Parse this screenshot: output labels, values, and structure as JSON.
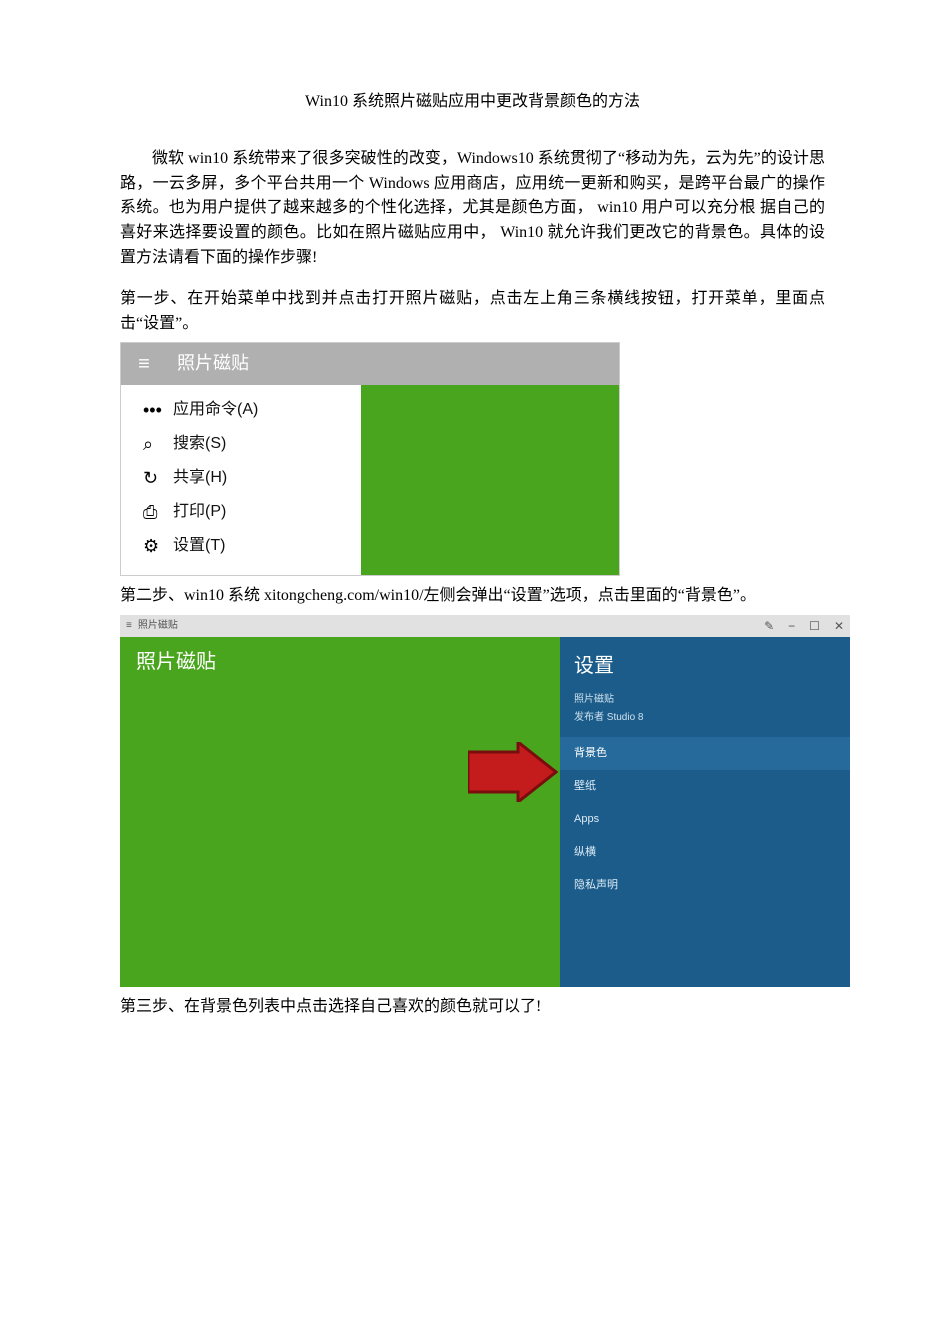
{
  "doc": {
    "title": "Win10 系统照片磁贴应用中更改背景颜色的方法",
    "intro": "微软 win10 系统带来了很多突破性的改变，Windows10 系统贯彻了“移动为先，云为先”的设计思路，一云多屏，多个平台共用一个 Windows 应用商店，应用统一更新和购买，是跨平台最广的操作系统。也为用户提供了越来越多的个性化选择，尤其是颜色方面， win10 用户可以充分根 据自己的喜好来选择要设置的颜色。比如在照片磁贴应用中， Win10 就允许我们更改它的背景色。具体的设置方法请看下面的操作步骤!",
    "step1": "第一步、在开始菜单中找到并点击打开照片磁贴，点击左上角三条横线按钮，打开菜单，里面点击“设置”。",
    "step2": "第二步、win10 系统 xitongcheng.com/win10/左侧会弹出“设置”选项，点击里面的“背景色”。",
    "step3": "第三步、在背景色列表中点击选择自己喜欢的颜色就可以了!"
  },
  "shot1": {
    "header_title": "照片磁贴",
    "hamburger_glyph": "≡",
    "menu": [
      {
        "icon": "•••",
        "label": "应用命令(A)",
        "name": "menu-item-app-commands",
        "icon_name": "ellipsis-icon"
      },
      {
        "icon": "⌕",
        "label": "搜索(S)",
        "name": "menu-item-search",
        "icon_name": "search-icon"
      },
      {
        "icon": "↻",
        "label": "共享(H)",
        "name": "menu-item-share",
        "icon_name": "share-icon"
      },
      {
        "icon": "⎙",
        "label": "打印(P)",
        "name": "menu-item-print",
        "icon_name": "print-icon"
      },
      {
        "icon": "⚙",
        "label": "设置(T)",
        "name": "menu-item-settings",
        "icon_name": "gear-icon"
      }
    ]
  },
  "shot2": {
    "titlebar_app": "照片磁贴",
    "titlebar_ham": "≡",
    "titlebar_icons": {
      "edit": "✎",
      "minimize": "−",
      "maximize": "☐",
      "close": "✕"
    },
    "main_title": "照片磁贴",
    "panel": {
      "title": "设置",
      "sub1": "照片磁贴",
      "sub2": "发布者 Studio 8",
      "items": [
        {
          "label": "背景色",
          "name": "settings-item-background-color",
          "selected": true
        },
        {
          "label": "壁纸",
          "name": "settings-item-wallpaper",
          "selected": false
        },
        {
          "label": "Apps",
          "name": "settings-item-apps",
          "selected": false
        },
        {
          "label": "纵横",
          "name": "settings-item-layout",
          "selected": false
        },
        {
          "label": "隐私声明",
          "name": "settings-item-privacy",
          "selected": false
        }
      ]
    }
  }
}
